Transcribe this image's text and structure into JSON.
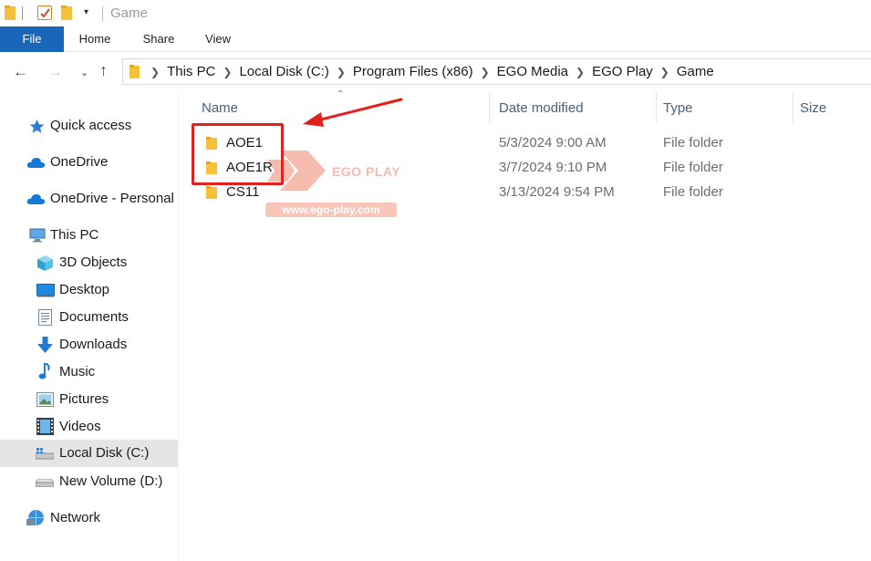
{
  "window": {
    "title": "Game"
  },
  "ribbon": {
    "tabs": [
      {
        "label": "File",
        "active": true
      },
      {
        "label": "Home"
      },
      {
        "label": "Share"
      },
      {
        "label": "View"
      }
    ]
  },
  "address_bar": {
    "crumbs": [
      "This PC",
      "Local Disk (C:)",
      "Program Files (x86)",
      "EGO Media",
      "EGO Play",
      "Game"
    ]
  },
  "sidebar": {
    "items": [
      {
        "label": "Quick access",
        "icon": "star-icon"
      },
      {
        "label": "OneDrive",
        "icon": "cloud-icon"
      },
      {
        "label": "OneDrive - Personal",
        "icon": "cloud-icon"
      },
      {
        "label": "This PC",
        "icon": "computer-icon"
      },
      {
        "label": "3D Objects",
        "icon": "cube-icon"
      },
      {
        "label": "Desktop",
        "icon": "desktop-icon"
      },
      {
        "label": "Documents",
        "icon": "document-icon"
      },
      {
        "label": "Downloads",
        "icon": "download-icon"
      },
      {
        "label": "Music",
        "icon": "music-note-icon"
      },
      {
        "label": "Pictures",
        "icon": "picture-icon"
      },
      {
        "label": "Videos",
        "icon": "film-icon"
      },
      {
        "label": "Local Disk (C:)",
        "icon": "drive-windows-icon",
        "selected": true
      },
      {
        "label": "New Volume (D:)",
        "icon": "drive-icon"
      },
      {
        "label": "Network",
        "icon": "network-icon"
      }
    ]
  },
  "file_list": {
    "columns": [
      "Name",
      "Date modified",
      "Type",
      "Size"
    ],
    "rows": [
      {
        "name": "AOE1",
        "date": "5/3/2024 9:00 AM",
        "type": "File folder"
      },
      {
        "name": "AOE1R",
        "date": "3/7/2024 9:10 PM",
        "type": "File folder"
      },
      {
        "name": "CS11",
        "date": "3/13/2024 9:54 PM",
        "type": "File folder"
      }
    ]
  },
  "watermark": {
    "brand": "EGO PLAY",
    "url": "www.ego-play.com"
  },
  "colors": {
    "accent": "#1a66b8",
    "folder": "#f5c13b",
    "annotation": "#e3201b",
    "selected": "#e5e5e5"
  }
}
